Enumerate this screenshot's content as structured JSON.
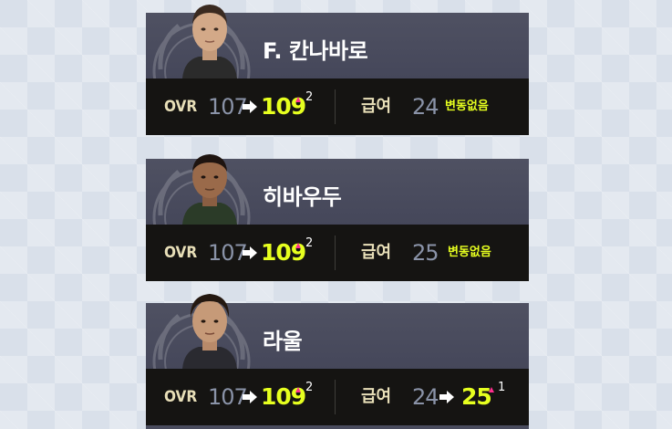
{
  "players": [
    {
      "name": "F. 칸나바로",
      "ovr_label": "OVR",
      "ovr_old": "107",
      "ovr_new": "109",
      "ovr_delta": "2",
      "pay_label": "급여",
      "pay_old": "24",
      "pay_status": "변동없음"
    },
    {
      "name": "히바우두",
      "ovr_label": "OVR",
      "ovr_old": "107",
      "ovr_new": "109",
      "ovr_delta": "2",
      "pay_label": "급여",
      "pay_old": "25",
      "pay_status": "변동없음"
    },
    {
      "name": "라울",
      "ovr_label": "OVR",
      "ovr_old": "107",
      "ovr_new": "109",
      "ovr_delta": "2",
      "pay_label": "급여",
      "pay_old": "24",
      "pay_new": "25",
      "pay_delta": "1"
    }
  ],
  "colors": {
    "new_value": "#e6ff1f",
    "increase_marker": "#ff2f8e",
    "label": "#e8dfb8",
    "old_value": "#8a93a8"
  },
  "icons": {
    "arrow": "arrow-right-icon",
    "increase": "triangle-up-icon",
    "emblem": "laurel-emblem-icon"
  }
}
